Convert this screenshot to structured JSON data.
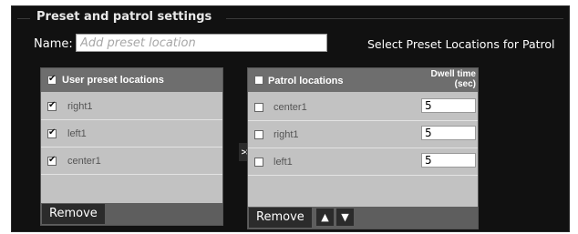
{
  "section": {
    "title": "Preset and patrol settings"
  },
  "name_field": {
    "label": "Name:",
    "placeholder": "Add preset location",
    "value": ""
  },
  "select_label": "Select Preset Locations for Patrol",
  "user_presets": {
    "header": "User preset locations",
    "header_checked": true,
    "items": [
      {
        "label": "right1",
        "checked": true
      },
      {
        "label": "left1",
        "checked": true
      },
      {
        "label": "center1",
        "checked": true
      }
    ],
    "remove_label": "Remove"
  },
  "transfer_button": ">>",
  "patrol": {
    "header": "Patrol locations",
    "dwell_header_line1": "Dwell time",
    "dwell_header_line2": "(sec)",
    "header_checked": false,
    "items": [
      {
        "label": "center1",
        "checked": false,
        "dwell": "5"
      },
      {
        "label": "right1",
        "checked": false,
        "dwell": "5"
      },
      {
        "label": "left1",
        "checked": false,
        "dwell": "5"
      }
    ],
    "remove_label": "Remove",
    "up_icon": "up-arrow-icon",
    "down_icon": "down-arrow-icon"
  }
}
